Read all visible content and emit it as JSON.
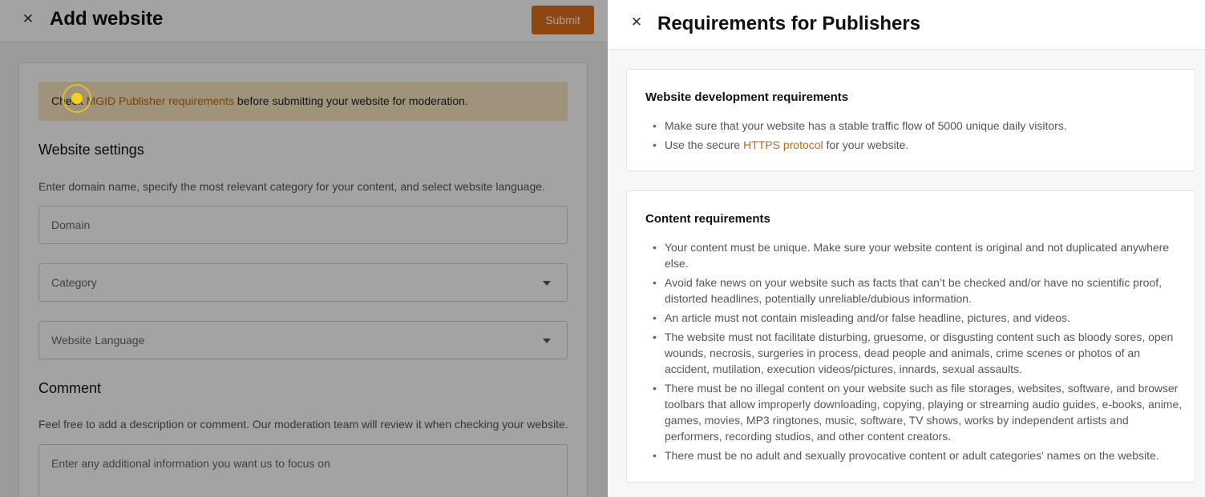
{
  "left": {
    "title": "Add website",
    "submit_label": "Submit",
    "notice": {
      "prefix": "Check ",
      "link": "MGID Publisher requirements",
      "suffix": " before submitting your website for moderation."
    },
    "settings_heading": "Website settings",
    "settings_help": "Enter domain name, specify the most relevant category for your content, and select website language.",
    "domain_placeholder": "Domain",
    "category_placeholder": "Category",
    "language_placeholder": "Website Language",
    "comment_heading": "Comment",
    "comment_help": "Feel free to add a description or comment. Our moderation team will review it when checking your website.",
    "comment_placeholder": "Enter any additional information you want us to focus on"
  },
  "right": {
    "title": "Requirements for Publishers",
    "dev": {
      "heading": "Website development requirements",
      "item1": "Make sure that your website has a stable traffic flow of 5000 unique daily visitors.",
      "item2_prefix": "Use the secure ",
      "item2_link": "HTTPS protocol",
      "item2_suffix": " for your website."
    },
    "content": {
      "heading": "Content requirements",
      "items": [
        "Your content must be unique. Make sure your website content is original and not duplicated anywhere else.",
        "Avoid fake news on your website such as facts that can’t be checked and/or have no scientific proof, distorted headlines, potentially unreliable/dubious information.",
        "An article must not contain misleading and/or false headline, pictures, and videos.",
        "The website must not facilitate disturbing, gruesome, or disgusting content such as bloody sores, open wounds, necrosis, surgeries in process, dead people and animals, crime scenes or photos of an accident, mutilation, execution videos/pictures, innards, sexual assaults.",
        "There must be no illegal content on your website such as file storages, websites, software, and browser toolbars that allow improperly downloading, copying, playing or streaming audio guides, e-books, anime, games, movies, MP3 ringtones, music, software, TV shows, works by independent artists and performers, recording studios, and other content creators.",
        "There must be no adult and sexually provocative content or adult categories' names on the website."
      ]
    }
  }
}
